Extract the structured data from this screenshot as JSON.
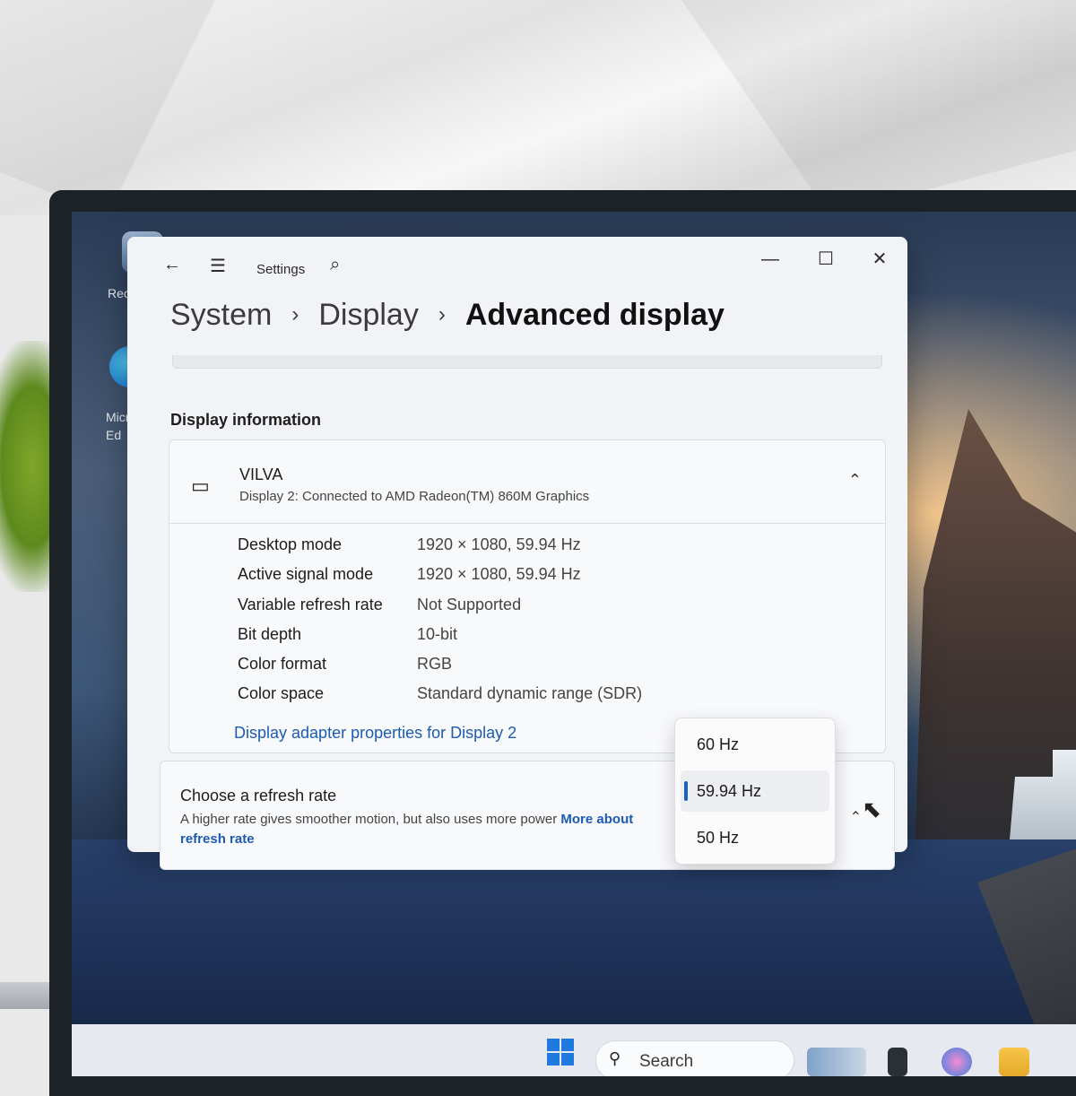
{
  "window": {
    "app_name": "Settings",
    "back_icon": "←",
    "menu_icon": "☰",
    "search_icon": "⌕",
    "minimize": "—",
    "maximize": "☐",
    "close": "✕"
  },
  "breadcrumb": {
    "items": [
      "System",
      "Display"
    ],
    "current": "Advanced display",
    "separator": "›"
  },
  "display_info": {
    "section_title": "Display information",
    "monitor_name": "VILVA",
    "monitor_subtitle": "Display 2: Connected to AMD Radeon(TM) 860M Graphics",
    "collapse_icon": "⌃",
    "rows": [
      {
        "label": "Desktop mode",
        "value": "1920 × 1080, 59.94 Hz"
      },
      {
        "label": "Active signal mode",
        "value": "1920 × 1080, 59.94 Hz"
      },
      {
        "label": "Variable refresh rate",
        "value": "Not Supported"
      },
      {
        "label": "Bit depth",
        "value": "10-bit"
      },
      {
        "label": "Color format",
        "value": "RGB"
      },
      {
        "label": "Color space",
        "value": "Standard dynamic range (SDR)"
      }
    ],
    "adapter_link": "Display adapter properties for Display 2"
  },
  "refresh_rate": {
    "title": "Choose a refresh rate",
    "description": "A higher rate gives smoother motion, but also uses more power",
    "more_link": "More about refresh rate",
    "options": [
      "60 Hz",
      "59.94 Hz",
      "50 Hz"
    ],
    "selected": "59.94 Hz",
    "chevron_icon": "⌃"
  },
  "desktop": {
    "icons": [
      "Recyc",
      "Micro\nEd"
    ]
  },
  "taskbar": {
    "search_placeholder": "Search"
  },
  "colors": {
    "accent": "#1565c0",
    "link": "#1c5bb0",
    "window_bg": "#f1f3f6"
  }
}
